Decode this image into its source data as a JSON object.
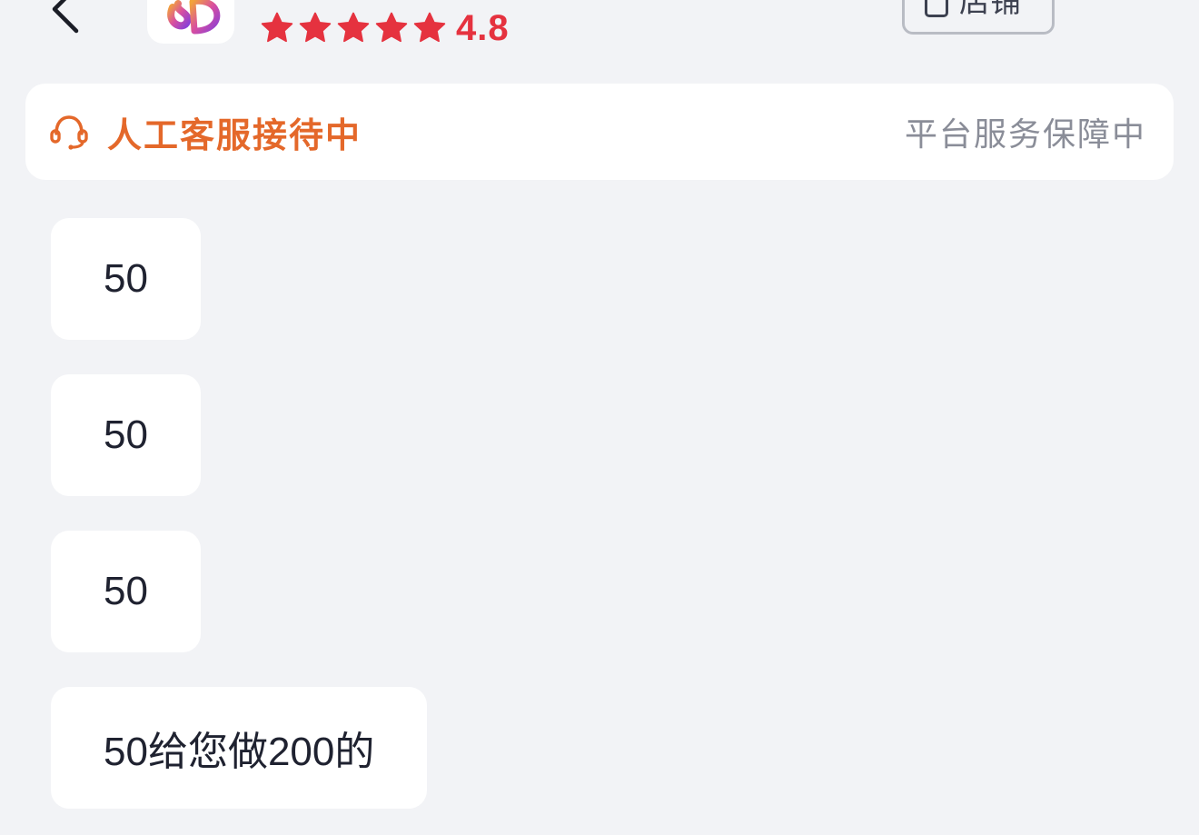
{
  "header": {
    "rating": {
      "stars": 5,
      "value": "4.8"
    },
    "shop_button_label": "店铺"
  },
  "service_banner": {
    "status": "人工客服接待中",
    "guarantee": "平台服务保障中"
  },
  "messages": [
    {
      "text": "50"
    },
    {
      "text": "50"
    },
    {
      "text": "50"
    },
    {
      "text": "50给您做200的"
    }
  ],
  "colors": {
    "rating_red": "#e5323f",
    "service_orange": "#e4682a",
    "muted_gray": "#8a8d98",
    "background": "#f2f3f6"
  },
  "icons": {
    "back": "chevron-left-icon",
    "logo": "store-logo",
    "star": "star-icon",
    "shop": "shop-bag-icon",
    "more": "more-dots-icon",
    "headset": "headset-icon"
  }
}
